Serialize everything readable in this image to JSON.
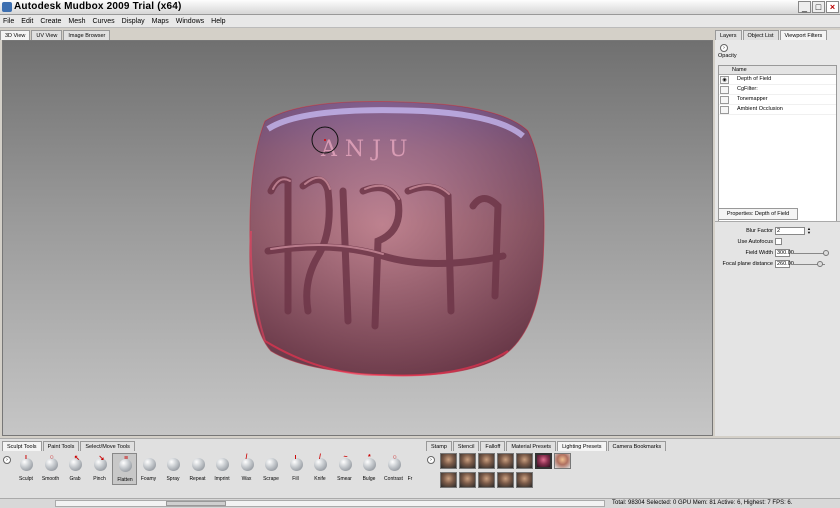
{
  "window": {
    "title": "Autodesk Mudbox 2009 Trial (x64)",
    "minimize": "_",
    "maximize": "□",
    "close": "×"
  },
  "menu": [
    "File",
    "Edit",
    "Create",
    "Mesh",
    "Curves",
    "Display",
    "Maps",
    "Windows",
    "Help"
  ],
  "viewport_tabs": [
    "3D View",
    "UV View",
    "Image Browser"
  ],
  "right_tabs": [
    "Layers",
    "Object List",
    "Viewport Filters"
  ],
  "filters": {
    "opacity_label": "Opacity",
    "column_name": "Name",
    "items": [
      "Depth of Field",
      "CgFilter:",
      "Tonemapper",
      "Ambient Occlusion"
    ]
  },
  "properties": {
    "title": "Properties: Depth of Field",
    "blur_factor_label": "Blur Factor",
    "blur_factor_value": "2",
    "use_autofocus_label": "Use Autofocus",
    "field_width_label": "Field Width",
    "field_width_value": "300.00",
    "focal_plane_label": "Focal plane distance",
    "focal_plane_value": "260.00"
  },
  "tool_tabs": [
    "Sculpt Tools",
    "Paint Tools",
    "Select/Move Tools"
  ],
  "tools": [
    "Sculpt",
    "Smooth",
    "Grab",
    "Pinch",
    "Flatten",
    "Foamy",
    "Spray",
    "Repeat",
    "Imprint",
    "Wax",
    "Scrape",
    "Fill",
    "Knife",
    "Smear",
    "Bulge",
    "Contrast",
    "Fr"
  ],
  "preset_tabs": [
    "Stamp",
    "Stencil",
    "Falloff",
    "Material Presets",
    "Lighting Presets",
    "Camera Bookmarks"
  ],
  "status": "Total: 98304  Selected: 0  GPU Mem: 81  Active: 6, Highest: 7  FPS: 6.",
  "viewport_text": "ANJU",
  "colors": {
    "model": "#b07080",
    "model_highlight": "#6a5ce8",
    "viewport_top": "#707070",
    "viewport_bottom": "#c6c6c6"
  },
  "icons": [
    "eye-icon",
    "expand-arrow-icon",
    "tool-sphere-icon",
    "lighting-preset-icon"
  ]
}
